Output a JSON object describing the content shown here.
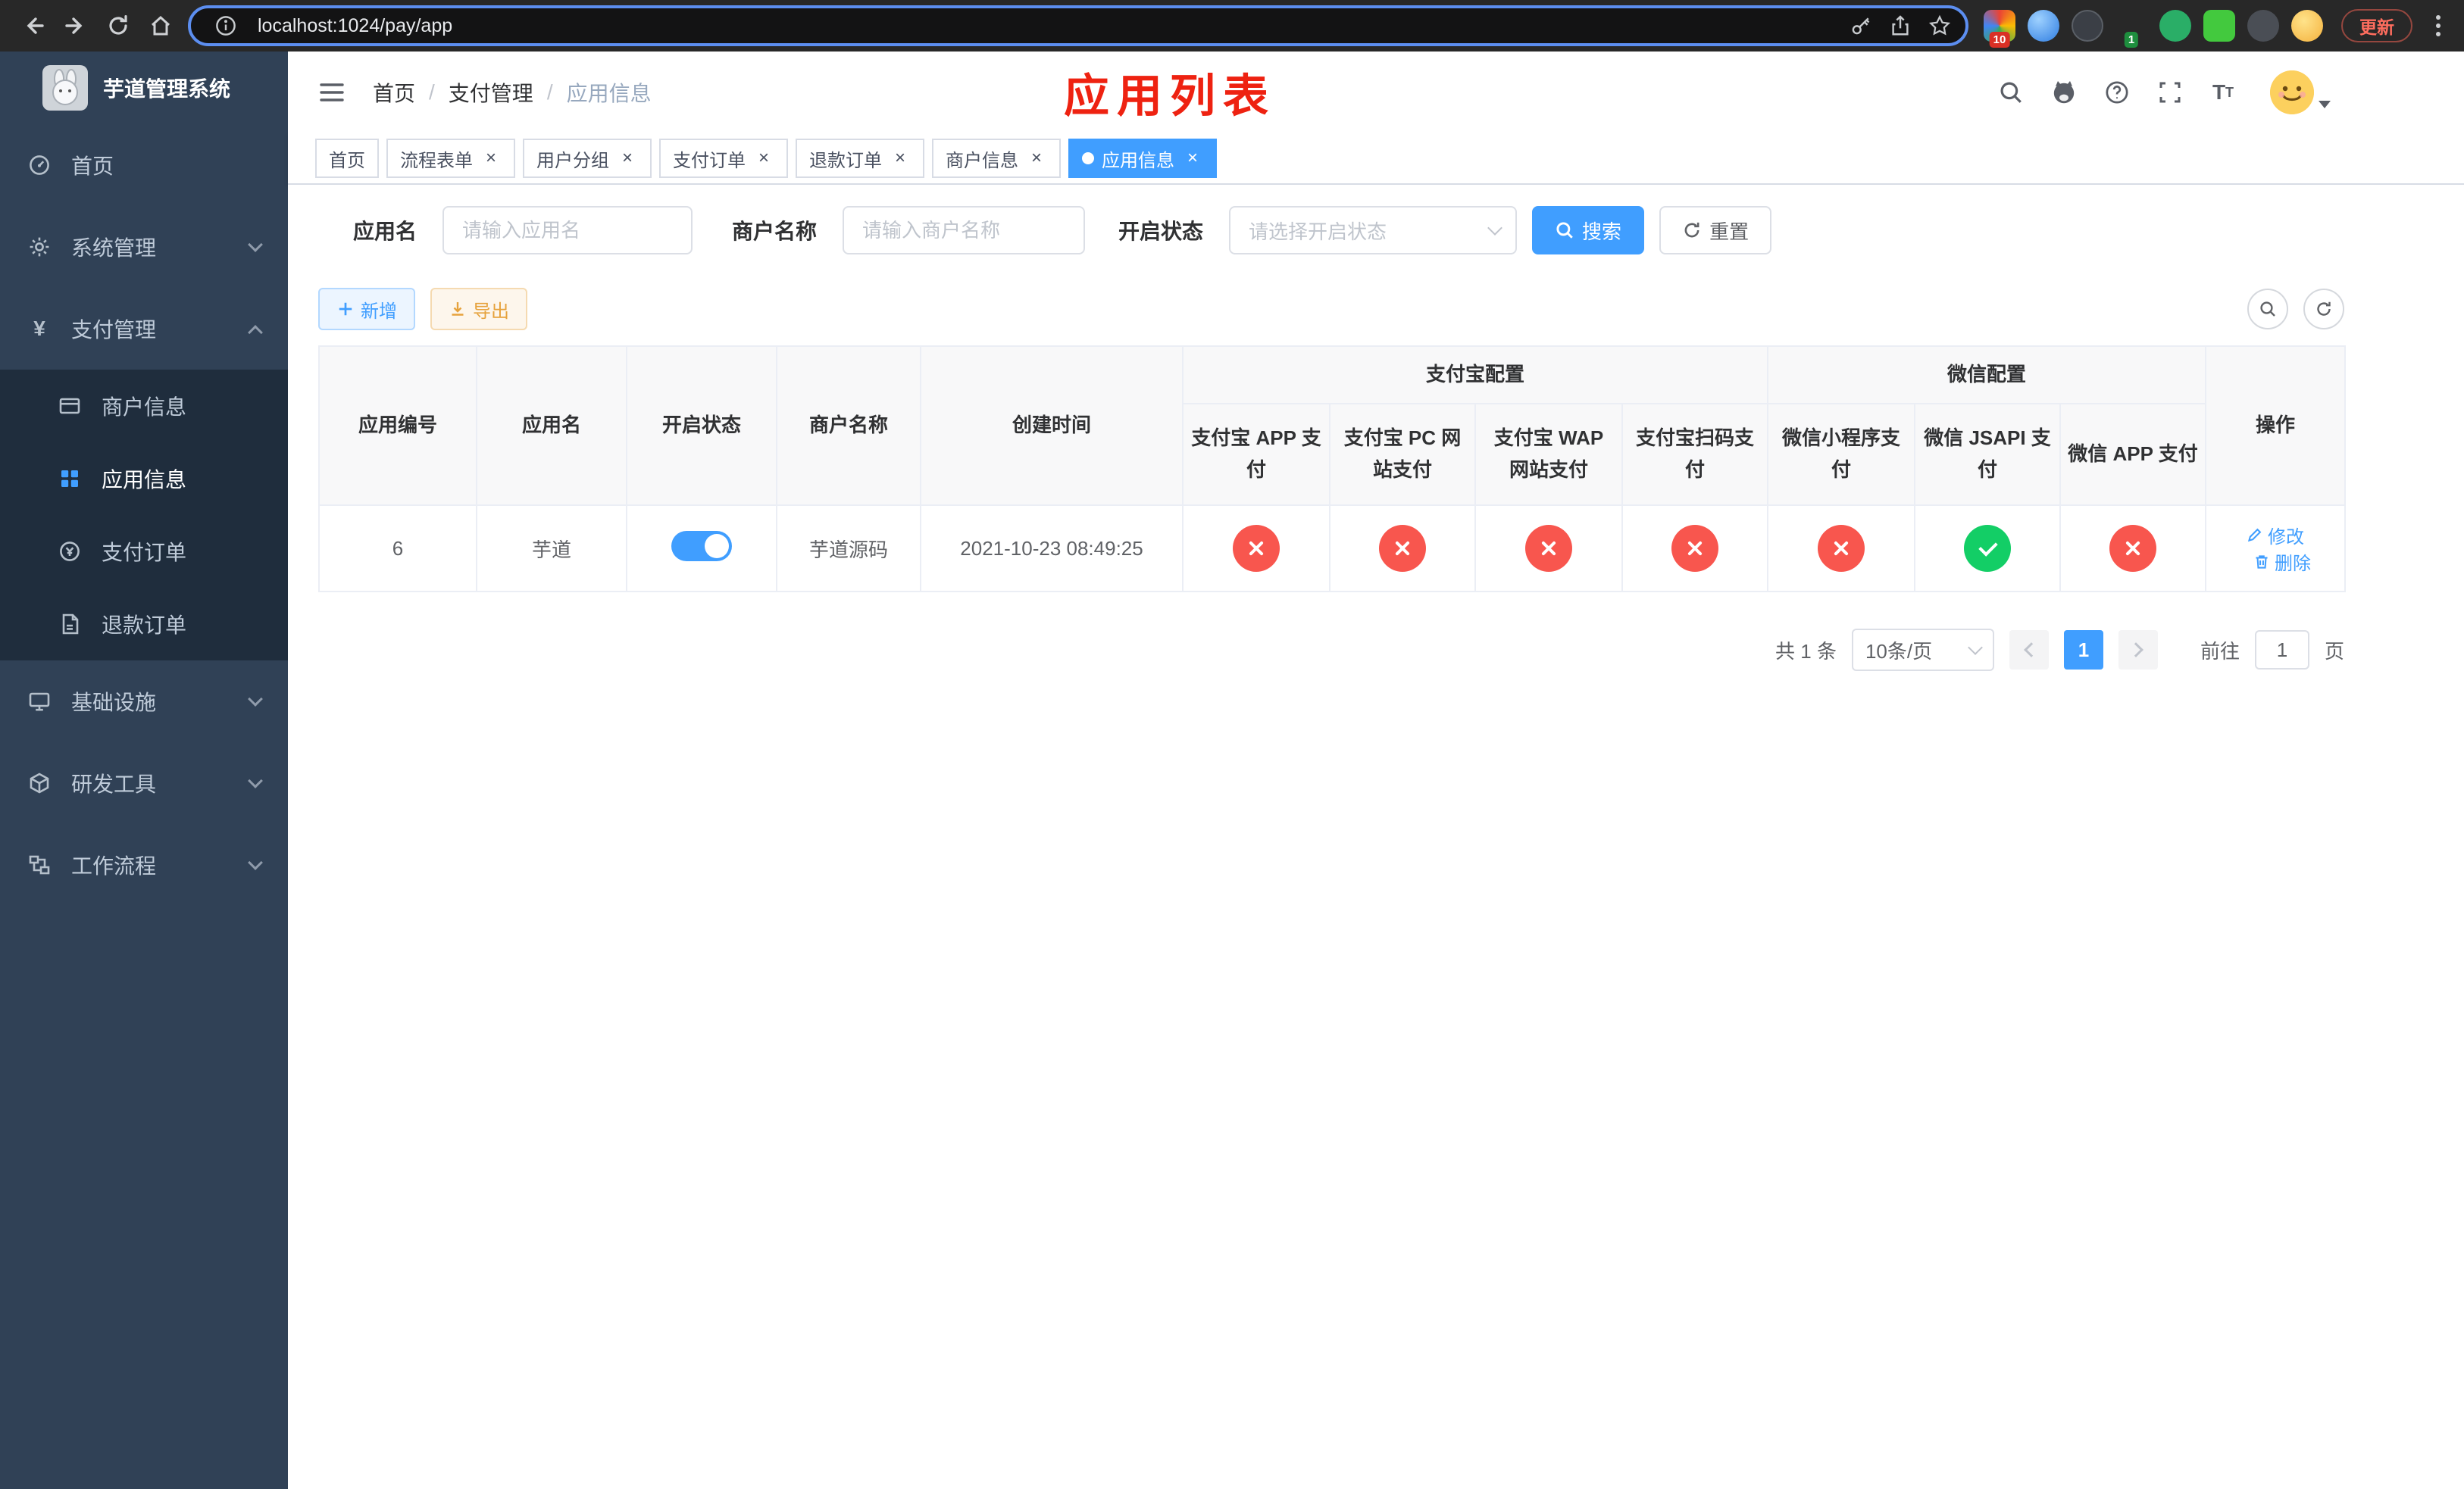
{
  "browser": {
    "url": "localhost:1024/pay/app",
    "update_label": "更新",
    "ext_badge_red": "10",
    "ext_badge_green": "1"
  },
  "sidebar": {
    "title": "芋道管理系统",
    "menu": [
      {
        "label": "首页"
      },
      {
        "label": "系统管理"
      },
      {
        "label": "支付管理"
      },
      {
        "label": "商户信息"
      },
      {
        "label": "应用信息"
      },
      {
        "label": "支付订单"
      },
      {
        "label": "退款订单"
      },
      {
        "label": "基础设施"
      },
      {
        "label": "研发工具"
      },
      {
        "label": "工作流程"
      }
    ]
  },
  "navbar": {
    "breadcrumb": [
      "首页",
      "支付管理",
      "应用信息"
    ],
    "annotation": "应用列表"
  },
  "tabs": [
    {
      "label": "首页"
    },
    {
      "label": "流程表单"
    },
    {
      "label": "用户分组"
    },
    {
      "label": "支付订单"
    },
    {
      "label": "退款订单"
    },
    {
      "label": "商户信息"
    },
    {
      "label": "应用信息"
    }
  ],
  "filters": {
    "app_name_label": "应用名",
    "app_name_placeholder": "请输入应用名",
    "merchant_label": "商户名称",
    "merchant_placeholder": "请输入商户名称",
    "status_label": "开启状态",
    "status_placeholder": "请选择开启状态",
    "search_label": "搜索",
    "reset_label": "重置"
  },
  "toolbar": {
    "add_label": "新增",
    "export_label": "导出"
  },
  "table": {
    "headers": {
      "app_id": "应用编号",
      "app_name": "应用名",
      "status": "开启状态",
      "merchant": "商户名称",
      "created": "创建时间",
      "alipay_group": "支付宝配置",
      "wechat_group": "微信配置",
      "alipay_app": "支付宝 APP 支付",
      "alipay_pc": "支付宝 PC 网站支付",
      "alipay_wap": "支付宝 WAP 网站支付",
      "alipay_qr": "支付宝扫码支付",
      "wx_mini": "微信小程序支付",
      "wx_jsapi": "微信 JSAPI 支付",
      "wx_app": "微信 APP 支付",
      "actions": "操作"
    },
    "row": {
      "app_id": "6",
      "app_name": "芋道",
      "status_on": true,
      "merchant": "芋道源码",
      "created": "2021-10-23 08:49:25",
      "configs": {
        "alipay_app": false,
        "alipay_pc": false,
        "alipay_wap": false,
        "alipay_qr": false,
        "wx_mini": false,
        "wx_jsapi": true,
        "wx_app": false
      },
      "edit_label": "修改",
      "delete_label": "删除"
    }
  },
  "pagination": {
    "total": "共 1 条",
    "page_size": "10条/页",
    "page": "1",
    "goto_label": "前往",
    "goto_value": "1",
    "unit_label": "页"
  },
  "colors": {
    "primary": "#409eff",
    "danger": "#f8564e",
    "success": "#13ce66",
    "sidebar_bg": "#304156",
    "submenu_bg": "#1f2d3d"
  }
}
